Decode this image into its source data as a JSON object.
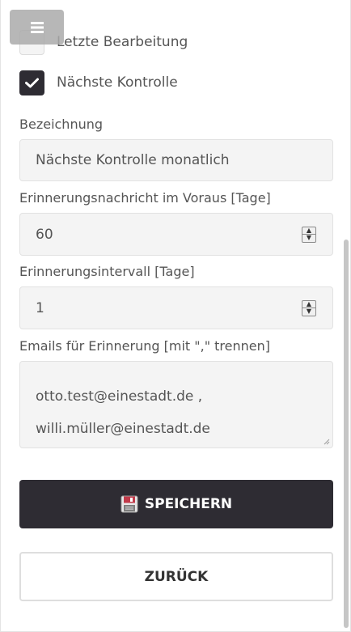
{
  "checkboxes": {
    "letzte": {
      "label": "Letzte Bearbeitung",
      "checked": false
    },
    "naechste": {
      "label": "Nächste Kontrolle",
      "checked": true
    }
  },
  "fields": {
    "bezeichnung": {
      "label": "Bezeichnung",
      "value": "Nächste Kontrolle monatlich"
    },
    "voraus": {
      "label": "Erinnerungsnachricht im Voraus [Tage]",
      "value": "60"
    },
    "intervall": {
      "label": "Erinnerungsintervall [Tage]",
      "value": "1"
    },
    "emails": {
      "label": "Emails für Erinnerung [mit \",\" trennen]",
      "lines": [
        "otto.test@einestadt.de ,",
        "willi.müller@einestadt.de"
      ]
    }
  },
  "buttons": {
    "save": "SPEICHERN",
    "back": "ZURÜCK"
  },
  "icons": {
    "menu": "hamburger-menu-icon",
    "check": "check-icon",
    "save": "floppy-disk-icon",
    "spinner": "spinner-arrows-icon",
    "resize": "resize-grip-icon"
  },
  "colors": {
    "primary": "#2e2c33",
    "field_bg": "#f4f4f4",
    "menu_button": "#aaaaaa"
  }
}
